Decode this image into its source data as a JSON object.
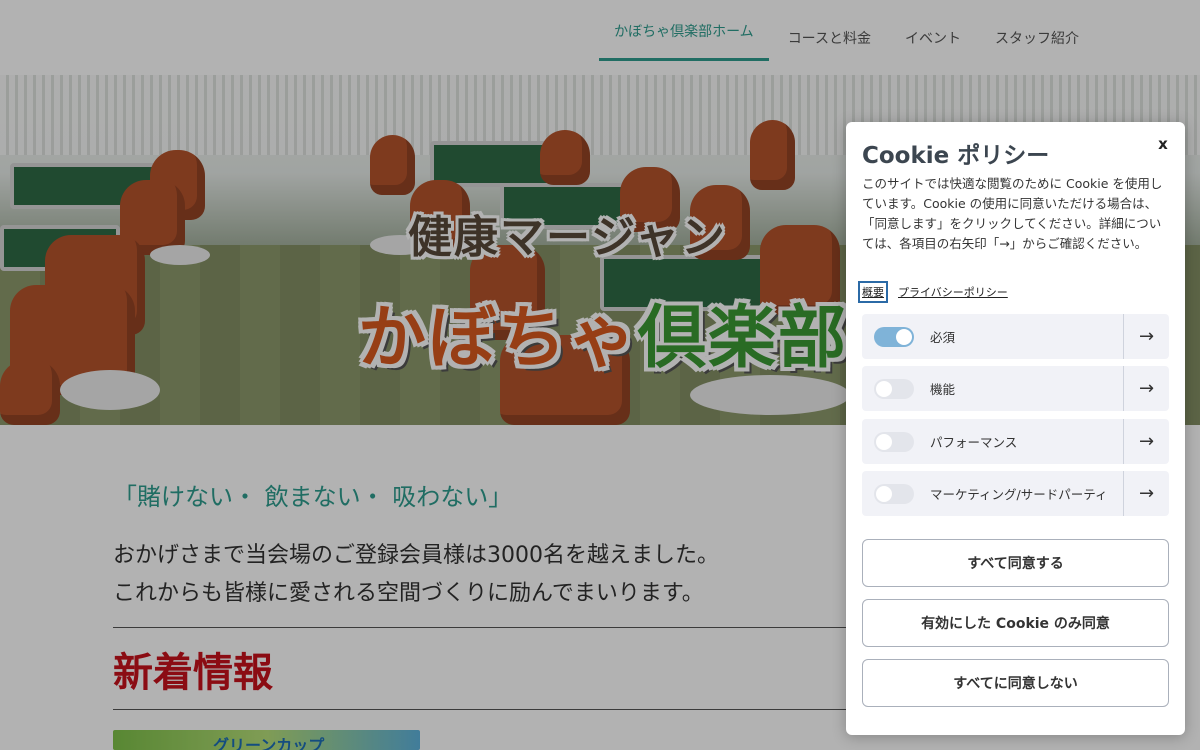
{
  "nav": {
    "items": [
      {
        "label": "かぼちゃ倶楽部ホーム",
        "active": true
      },
      {
        "label": "コースと料金",
        "active": false
      },
      {
        "label": "イベント",
        "active": false
      },
      {
        "label": "スタッフ紹介",
        "active": false
      }
    ]
  },
  "hero": {
    "title": "健康マージャン",
    "brand_part1": "かぼちゃ",
    "brand_part2": "倶楽部"
  },
  "main": {
    "tagline": "「賭けない・ 飲まない・ 吸わない」",
    "intro_line1": "おかげさまで当会場のご登録会員様は3000名を越えました。",
    "intro_line2": "これからも皆様に愛される空間づくりに励んでまいります。",
    "news_title": "新着情報",
    "banner_text": "グリーンカップ"
  },
  "cookie": {
    "title": "Cookie ポリシー",
    "close_label": "x",
    "description": "このサイトでは快適な閲覧のために Cookie を使用しています。Cookie の使用に同意いただける場合は、「同意します」をクリックしてください。詳細については、各項目の右矢印「→」からご確認ください。",
    "link_overview": "概要",
    "link_privacy": "プライバシーポリシー",
    "categories": [
      {
        "label": "必須",
        "enabled": true
      },
      {
        "label": "機能",
        "enabled": false
      },
      {
        "label": "パフォーマンス",
        "enabled": false
      },
      {
        "label": "マーケティング/サードパーティ",
        "enabled": false
      }
    ],
    "arrow": "→",
    "buttons": {
      "accept_all": "すべて同意する",
      "accept_selected": "有効にした Cookie のみ同意",
      "reject_all": "すべてに同意しない"
    }
  },
  "colors": {
    "accent": "#2f9d8e",
    "news_red": "#c8121c",
    "toggle_on": "#7fb3d8"
  }
}
